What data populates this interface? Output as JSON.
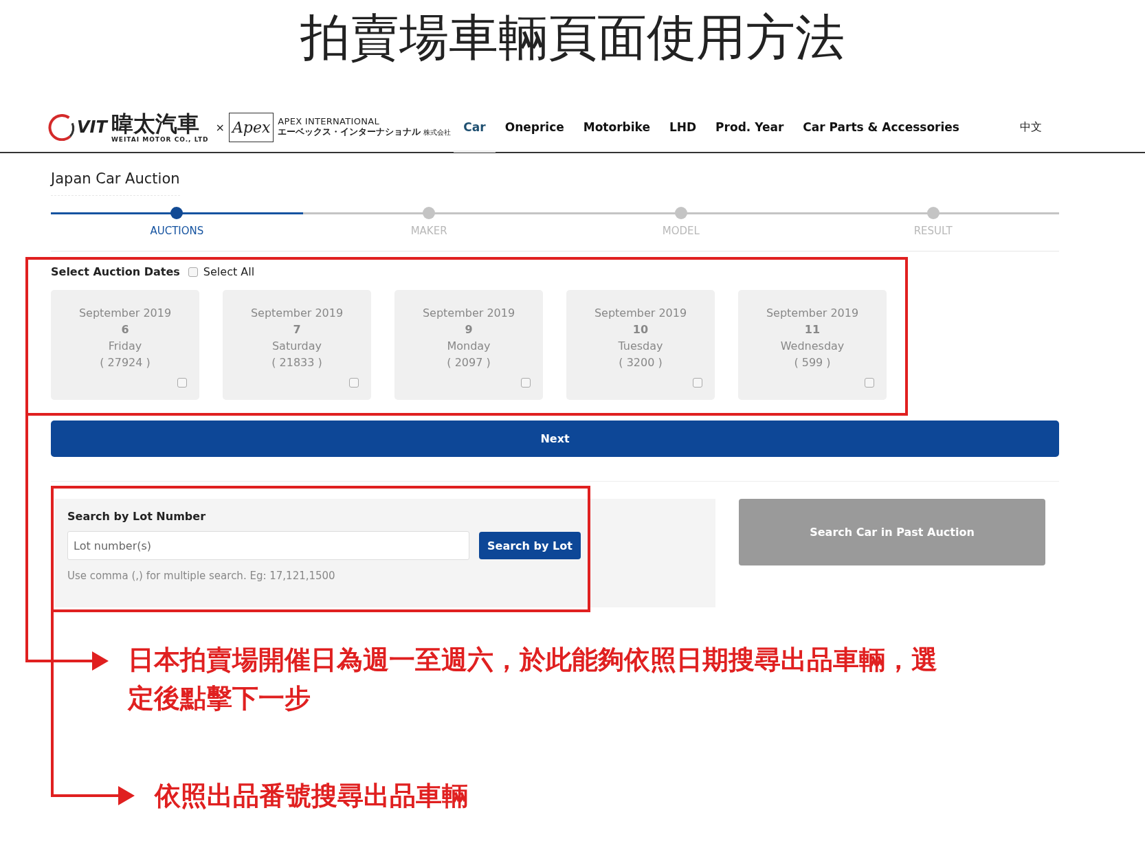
{
  "page_title": "拍賣場車輛頁面使用方法",
  "nav": {
    "logo": {
      "mark": "VIT",
      "brand_cn": "暐太汽車",
      "brand_en": "WEITAI MOTOR CO., LTD",
      "separator": "×",
      "partner_script": "Apex",
      "partner_en": "APEX INTERNATIONAL",
      "partner_jp": "エーベックス・インターナショナル",
      "partner_jp_suffix": "株式会社"
    },
    "items": [
      {
        "label": "Car",
        "selected": true
      },
      {
        "label": "Oneprice",
        "selected": false
      },
      {
        "label": "Motorbike",
        "selected": false
      },
      {
        "label": "LHD",
        "selected": false
      },
      {
        "label": "Prod. Year",
        "selected": false
      },
      {
        "label": "Car Parts & Accessories",
        "selected": false
      }
    ],
    "language": "中文"
  },
  "section_title": "Japan Car Auction",
  "steps": [
    {
      "label": "AUCTIONS",
      "selected": true
    },
    {
      "label": "MAKER",
      "selected": false
    },
    {
      "label": "MODEL",
      "selected": false
    },
    {
      "label": "RESULT",
      "selected": false
    }
  ],
  "dates": {
    "label": "Select Auction Dates",
    "select_all": {
      "label": "Select All",
      "checked": false
    },
    "cards": [
      {
        "month": "September 2019",
        "day": "6",
        "weekday": "Friday",
        "count": "( 27924 )",
        "checked": false
      },
      {
        "month": "September 2019",
        "day": "7",
        "weekday": "Saturday",
        "count": "( 21833 )",
        "checked": false
      },
      {
        "month": "September 2019",
        "day": "9",
        "weekday": "Monday",
        "count": "( 2097 )",
        "checked": false
      },
      {
        "month": "September 2019",
        "day": "10",
        "weekday": "Tuesday",
        "count": "( 3200 )",
        "checked": false
      },
      {
        "month": "September 2019",
        "day": "11",
        "weekday": "Wednesday",
        "count": "( 599 )",
        "checked": false
      }
    ]
  },
  "next_button": "Next",
  "lot_search": {
    "title": "Search by Lot Number",
    "placeholder": "Lot number(s)",
    "button": "Search by Lot",
    "hint": "Use comma (,) for multiple search. Eg: 17,121,1500"
  },
  "past_auction_button": "Search Car in Past Auction",
  "annotations": [
    {
      "text": "日本拍賣場開催日為週一至週六，於此能夠依照日期搜尋出品車輛，選定後點擊下一步"
    },
    {
      "text": "依照出品番號搜尋出品車輛"
    }
  ]
}
